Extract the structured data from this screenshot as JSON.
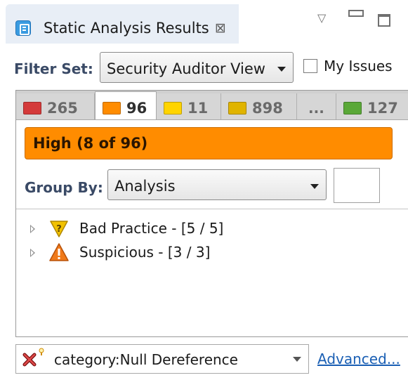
{
  "view": {
    "title": "Static Analysis Results",
    "close_glyph": "⊠",
    "menu_glyph": "▽"
  },
  "filter": {
    "label": "Filter Set:",
    "selected": "Security Auditor View",
    "my_issues_label": "My Issues",
    "my_issues_checked": false
  },
  "severity_tabs": [
    {
      "color": "#d43a3a",
      "count": "265",
      "active": false
    },
    {
      "color": "#ff8c00",
      "count": "96",
      "active": true
    },
    {
      "color": "#ffd400",
      "count": "11",
      "active": false
    },
    {
      "color": "#e0b400",
      "count": "898",
      "active": false
    },
    {
      "more": "..."
    },
    {
      "color": "#5aa838",
      "count": "127",
      "active": false
    }
  ],
  "severity_banner": {
    "text": "High (8 of 96)",
    "color": "#ff8c00"
  },
  "group_by": {
    "label": "Group By:",
    "selected": "Analysis"
  },
  "tree": [
    {
      "icon": "bad-practice-icon",
      "label": "Bad Practice - [5 / 5]"
    },
    {
      "icon": "suspicious-icon",
      "label": "Suspicious - [3 / 3]"
    }
  ],
  "search": {
    "value": "category:Null Dereference"
  },
  "advanced_link": "Advanced..."
}
